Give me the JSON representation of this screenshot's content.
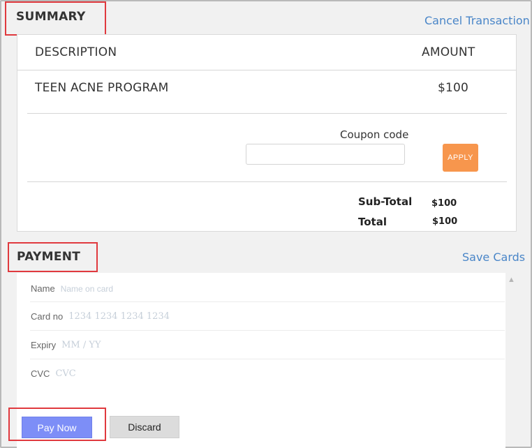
{
  "summary": {
    "title": "SUMMARY",
    "cancel_link": "Cancel Transaction",
    "col_description": "DESCRIPTION",
    "col_amount": "AMOUNT",
    "items": [
      {
        "description": "TEEN ACNE PROGRAM",
        "amount": "$100"
      }
    ],
    "coupon_label": "Coupon code",
    "coupon_value": "",
    "apply_label": "APPLY",
    "subtotal_label": "Sub-Total",
    "subtotal_value": "$100",
    "total_label": "Total",
    "total_value": "$100"
  },
  "payment": {
    "title": "PAYMENT",
    "save_cards_link": "Save Cards",
    "fields": {
      "name": {
        "label": "Name",
        "placeholder": "Name on card"
      },
      "card_no": {
        "label": "Card no",
        "placeholder": "1234 1234 1234 1234"
      },
      "expiry": {
        "label": "Expiry",
        "placeholder": "MM / YY"
      },
      "cvc": {
        "label": "CVC",
        "placeholder": "CVC"
      }
    },
    "pay_now_label": "Pay Now",
    "discard_label": "Discard"
  },
  "icons": {
    "scroll_up": "chevron-up-icon"
  },
  "colors": {
    "link": "#4a86c8",
    "apply": "#f7964d",
    "pay_now": "#7d8ef7",
    "highlight_box": "#e0393e"
  }
}
